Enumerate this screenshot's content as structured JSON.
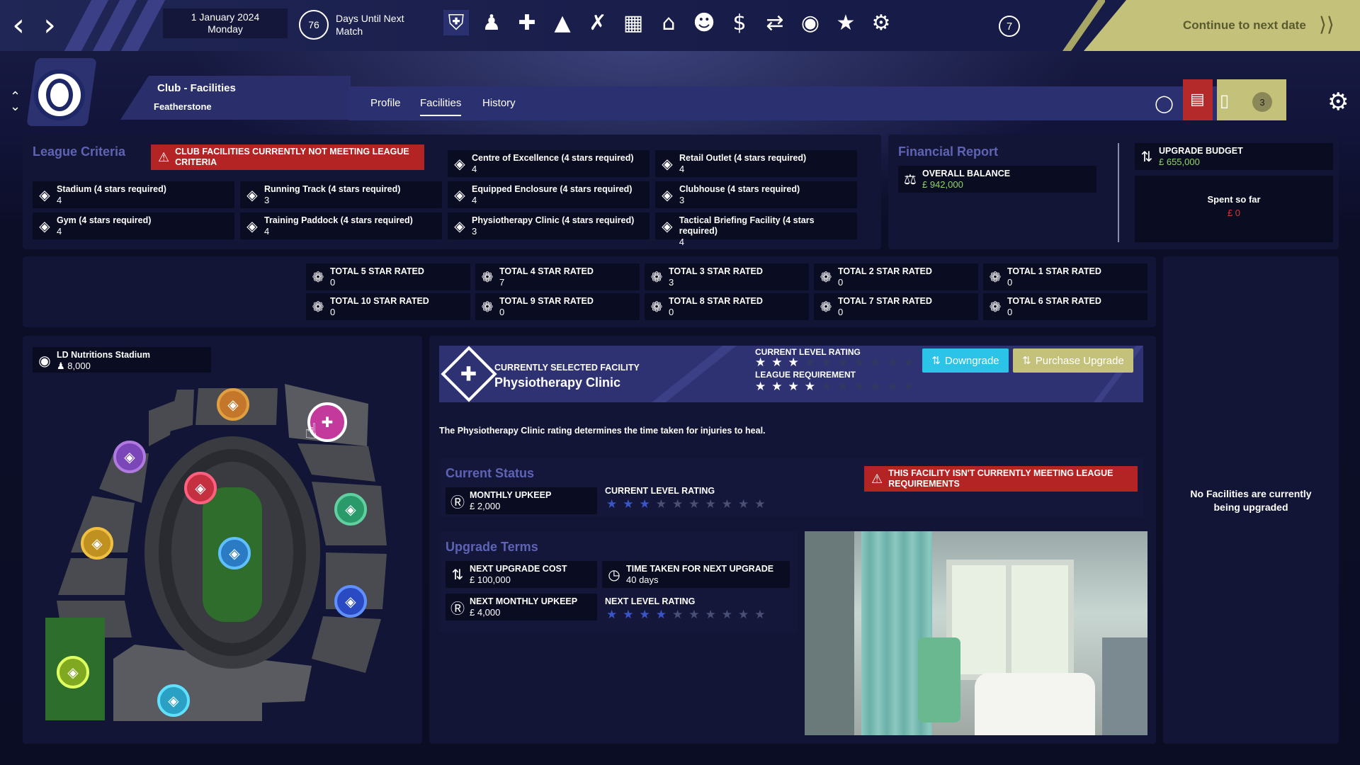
{
  "topbar": {
    "date": "1 January 2024",
    "weekday": "Monday",
    "days_until": "76",
    "days_label": "Days Until Next Match",
    "icons": [
      "shield-icon",
      "player-icon",
      "medical-icon",
      "coach-icon",
      "tactics-icon",
      "calendar-icon",
      "home-icon",
      "squad-icon",
      "finance-icon",
      "transfer-icon",
      "scouting-icon",
      "trophy-icon",
      "settings-cog-icon"
    ],
    "help_label": "7",
    "continue_label": "Continue to next date"
  },
  "header": {
    "title": "Club - Facilities",
    "club": "Featherstone",
    "tabs": [
      "Profile",
      "Facilities",
      "History"
    ],
    "active_tab": "Facilities",
    "inbox_count": "3"
  },
  "league_criteria": {
    "title": "League Criteria",
    "warning": "CLUB FACILITIES CURRENTLY NOT MEETING LEAGUE CRITERIA",
    "items": [
      {
        "label": "Centre of Excellence (4 stars required)",
        "value": "4"
      },
      {
        "label": "Retail Outlet (4 stars required)",
        "value": "4"
      },
      {
        "label": "Stadium (4 stars required)",
        "value": "4"
      },
      {
        "label": "Running Track (4 stars required)",
        "value": "3"
      },
      {
        "label": "Equipped Enclosure (4 stars required)",
        "value": "4"
      },
      {
        "label": "Clubhouse (4 stars required)",
        "value": "3"
      },
      {
        "label": "Gym (4 stars required)",
        "value": "4"
      },
      {
        "label": "Training Paddock (4 stars required)",
        "value": "4"
      },
      {
        "label": "Physiotherapy Clinic (4 stars required)",
        "value": "3"
      },
      {
        "label": "Tactical Briefing Facility (4 stars required)",
        "value": "4"
      }
    ]
  },
  "financial": {
    "title": "Financial Report",
    "balance_label": "OVERALL BALANCE",
    "balance_value": "£ 942,000",
    "budget_label": "UPGRADE BUDGET",
    "budget_value": "£ 655,000",
    "spent_label": "Spent so far",
    "spent_value": "£ 0"
  },
  "totals": [
    {
      "label": "TOTAL 5 STAR RATED",
      "value": "0"
    },
    {
      "label": "TOTAL 4 STAR RATED",
      "value": "7"
    },
    {
      "label": "TOTAL 3 STAR RATED",
      "value": "3"
    },
    {
      "label": "TOTAL 2 STAR RATED",
      "value": "0"
    },
    {
      "label": "TOTAL 1 STAR RATED",
      "value": "0"
    },
    {
      "label": "TOTAL 10 STAR RATED",
      "value": "0"
    },
    {
      "label": "TOTAL 9 STAR RATED",
      "value": "0"
    },
    {
      "label": "TOTAL 8 STAR RATED",
      "value": "0"
    },
    {
      "label": "TOTAL 7 STAR RATED",
      "value": "0"
    },
    {
      "label": "TOTAL 6 STAR RATED",
      "value": "0"
    }
  ],
  "stadium": {
    "name": "LD Nutritions Stadium",
    "capacity": "8,000"
  },
  "selected": {
    "caption": "CURRENTLY SELECTED FACILITY",
    "name": "Physiotherapy Clinic",
    "current_label": "CURRENT LEVEL RATING",
    "current_rating": 3,
    "league_label": "LEAGUE REQUIREMENT",
    "league_rating": 4,
    "max_rating": 10,
    "downgrade_label": "Downgrade",
    "upgrade_label": "Purchase Upgrade",
    "description": "The Physiotherapy Clinic rating determines the time taken for injuries to heal."
  },
  "current_status": {
    "title": "Current Status",
    "warning": "THIS FACILITY ISN'T CURRENTLY MEETING LEAGUE REQUIREMENTS",
    "upkeep_label": "MONTHLY UPKEEP",
    "upkeep_value": "£ 2,000",
    "rating_label": "CURRENT LEVEL RATING",
    "rating": 3
  },
  "upgrade_terms": {
    "title": "Upgrade Terms",
    "cost_label": "NEXT UPGRADE COST",
    "cost_value": "£ 100,000",
    "time_label": "TIME TAKEN FOR NEXT UPGRADE",
    "time_value": "40 days",
    "upkeep_label": "NEXT MONTHLY UPKEEP",
    "upkeep_value": "£ 4,000",
    "rating_label": "NEXT LEVEL RATING",
    "rating": 4
  },
  "upgrading": {
    "message": "No Facilities are currently being upgraded"
  },
  "colors": {
    "accent": "#5e63b3",
    "warning": "#b52424",
    "downgrade": "#2bc4e8",
    "upgrade": "#c4c27a"
  }
}
